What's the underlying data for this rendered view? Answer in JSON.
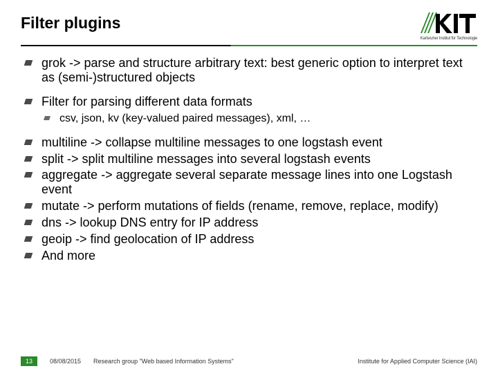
{
  "header": {
    "title": "Filter plugins",
    "logo_text": "KIT",
    "logo_caption": "Karlsruher Institut für Technologie"
  },
  "bullets": {
    "b1": "grok -> parse and structure arbitrary text: best generic option to interpret text as (semi-)structured objects",
    "b2": "Filter for parsing different data formats",
    "b2_sub": "csv, json, kv (key-valued paired messages), xml, …",
    "b3": "multiline -> collapse multiline messages to one logstash event",
    "b4": "split -> split multiline messages into several logstash events",
    "b5": "aggregate -> aggregate several separate message lines into one Logstash event",
    "b6": "mutate -> perform mutations of fields (rename, remove, replace, modify)",
    "b7": "dns -> lookup DNS entry for IP address",
    "b8": "geoip -> find geolocation of IP address",
    "b9": "And more"
  },
  "footer": {
    "page": "13",
    "date": "08/08/2015",
    "group": "Research group \"Web based Information Systems\"",
    "institute": "Institute for Applied Computer Science (IAI)"
  }
}
